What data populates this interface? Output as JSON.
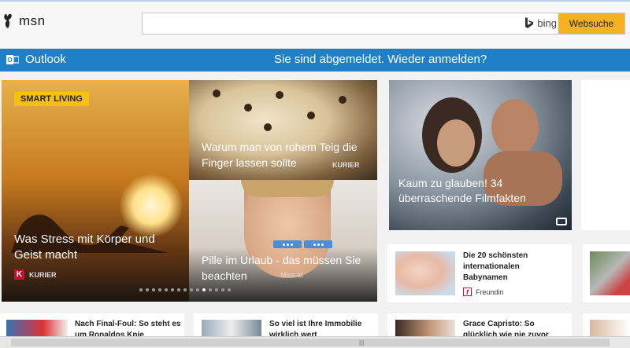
{
  "header": {
    "logo": "msn",
    "search_placeholder": "",
    "bing": "bing",
    "search_button": "Websuche"
  },
  "outlook": {
    "label": "Outlook",
    "message": "Sie sind abgemeldet. Wieder anmelden?"
  },
  "hero": {
    "badge": "SMART LIVING",
    "main_title": "Was Stress mit Körper und Geist macht",
    "main_source": "KURIER",
    "top_right_title": "Warum man von rohem Teig die Finger lassen sollte",
    "top_right_source": "KURIER",
    "bottom_right_title": "Pille im Urlaub - das müssen Sie beachten",
    "bottom_right_source": "Miss.at",
    "dots_count": 15,
    "active_dot": 10
  },
  "big_card": {
    "title": "Kaum zu glauben! 34 überraschende Filmfakten"
  },
  "baby_card": {
    "title": "Die 20 schönsten internationalen Babynamen",
    "source": "Freundin"
  },
  "bottom_row": [
    {
      "title": "Nach Final-Foul: So steht es um Ronaldos Knie"
    },
    {
      "title": "So viel ist Ihre Immobilie wirklich wert"
    },
    {
      "title": "Grace Capristo: So glücklich wie nie zuvor"
    }
  ],
  "colors": {
    "accent_blue": "#1f7fc7",
    "search_button": "#f4b223",
    "badge": "#f4c20d"
  }
}
